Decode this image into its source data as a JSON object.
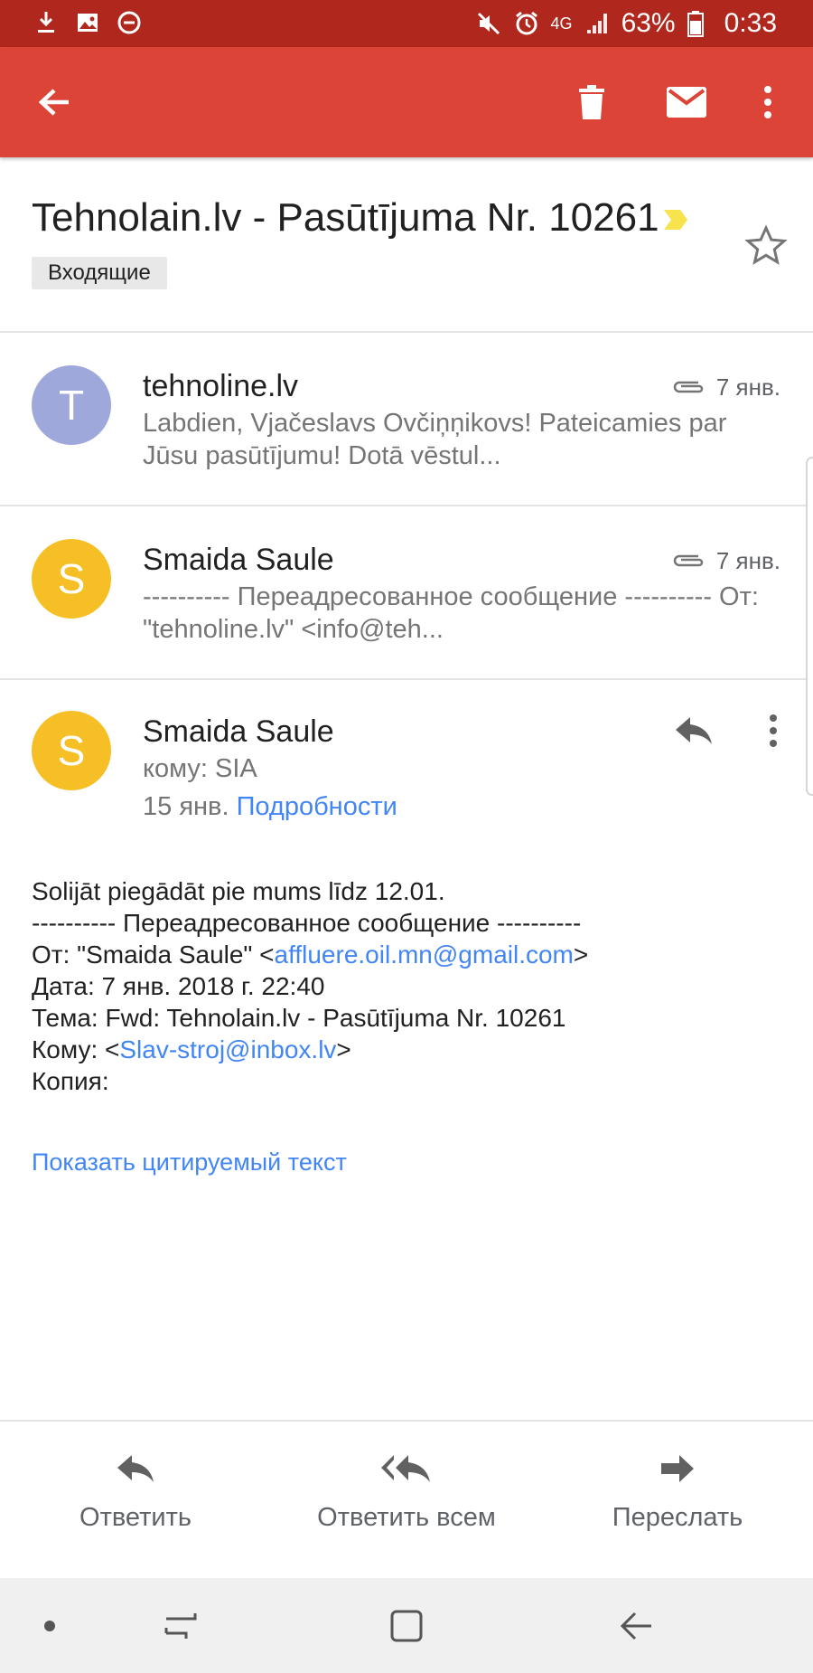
{
  "status_bar": {
    "battery": "63%",
    "time": "0:33",
    "network": "4G",
    "icons": [
      "download-icon",
      "image-icon",
      "do-not-disturb-icon",
      "mute-icon",
      "alarm-icon",
      "signal-icon",
      "battery-icon"
    ]
  },
  "app_bar": {
    "color": "#db4437",
    "icons": [
      "back-arrow-icon",
      "delete-icon",
      "mark-unread-icon",
      "more-vert-icon"
    ]
  },
  "thread": {
    "subject": "Tehnolain.lv - Pasūtījuma Nr. 10261",
    "label": "Входящие"
  },
  "messages": [
    {
      "initial": "T",
      "avatar_color": "#9fa8da",
      "sender": "tehnoline.lv",
      "date": "7 янв.",
      "snippet": "Labdien, Vjačeslavs Ovčiņņikovs! Pateicamies par Jūsu pasūtījumu! Dotā vēstul..."
    },
    {
      "initial": "S",
      "avatar_color": "#f6bf26",
      "sender": "Smaida Saule",
      "date": "7 янв.",
      "snippet": "---------- Переадресованное сообщение ---------- От: \"tehnoline.lv\" <info@teh..."
    }
  ],
  "expanded": {
    "initial": "S",
    "avatar_color": "#f6bf26",
    "sender": "Smaida Saule",
    "to": "кому: SIA",
    "date": "15 янв.",
    "details": "Подробности",
    "body": {
      "line1": "Solijāt piegādāt pie mums līdz 12.01.",
      "line2": "---------- Переадресованное сообщение ----------",
      "from_prefix": "От: \"Smaida Saule\" <",
      "from_email": "affluere.oil.mn@gmail.com",
      "from_suffix": ">",
      "date_line": "Дата: 7 янв. 2018 г. 22:40",
      "subject_line": "Тема: Fwd: Tehnolain.lv - Pasūtījuma Nr. 10261",
      "to_prefix": "Кому: <",
      "to_email": "Slav-stroj@inbox.lv",
      "to_suffix": ">",
      "cc_line": "Копия:"
    },
    "show_quoted": "Показать цитируемый текст"
  },
  "actions": {
    "reply": "Ответить",
    "reply_all": "Ответить всем",
    "forward": "Переслать"
  },
  "accent_link": "#4285f4"
}
